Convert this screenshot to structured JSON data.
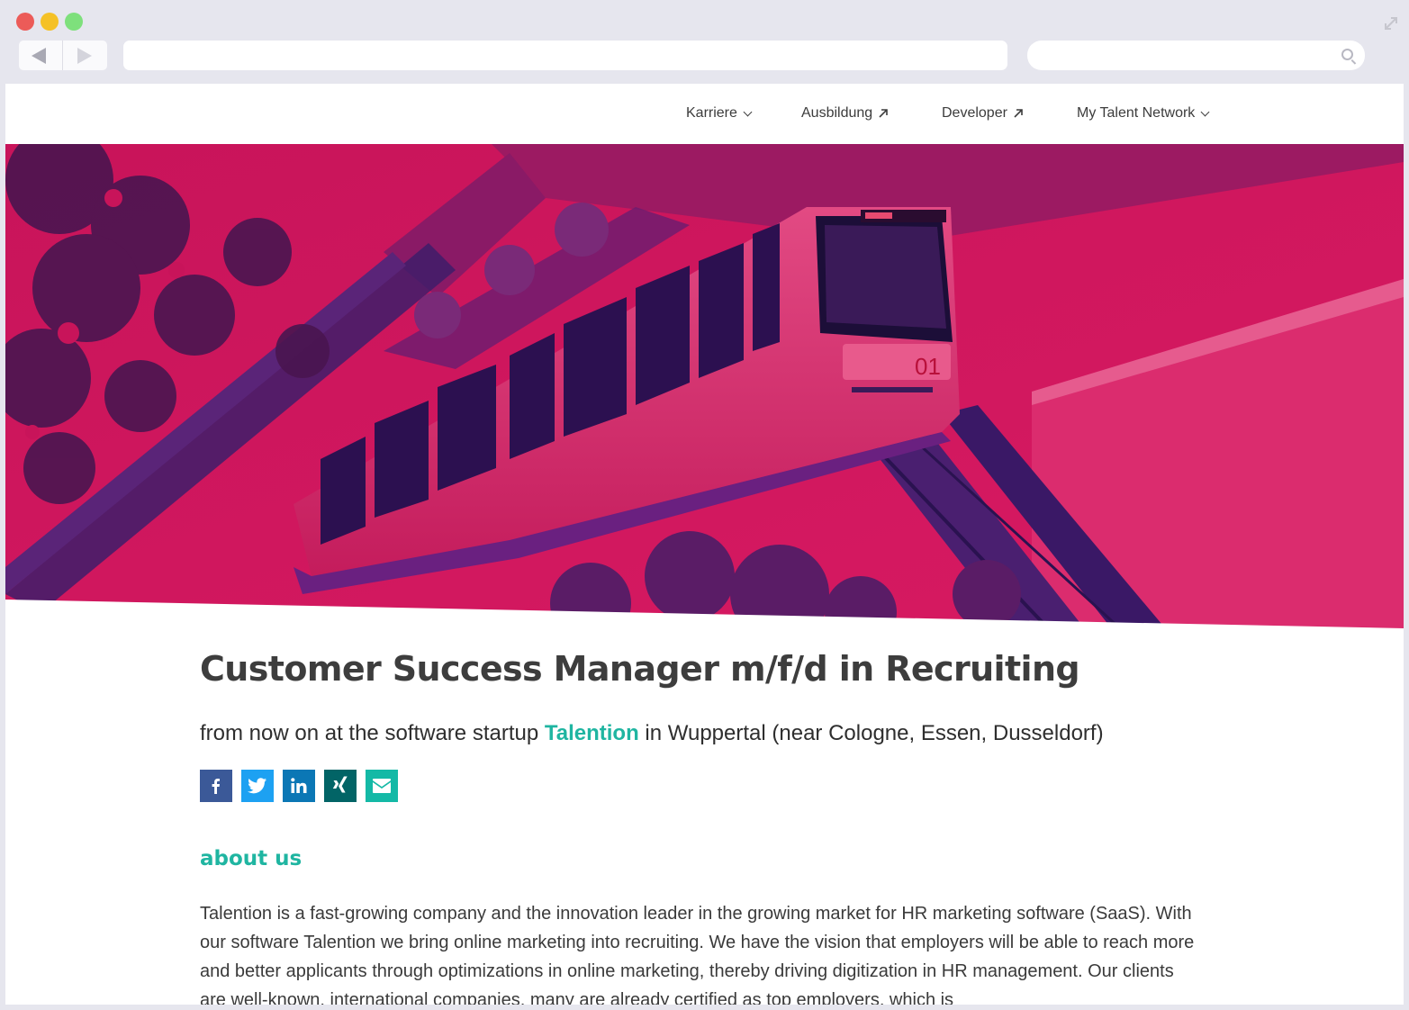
{
  "browser": {
    "url": "",
    "search_placeholder": ""
  },
  "nav": {
    "items": [
      {
        "label": "Karriere",
        "icon": "chevron-down-icon"
      },
      {
        "label": "Ausbildung",
        "icon": "external-arrow-icon"
      },
      {
        "label": "Developer",
        "icon": "external-arrow-icon"
      },
      {
        "label": "My Talent Network",
        "icon": "chevron-down-icon"
      }
    ]
  },
  "hero": {
    "tint_color": "#d4145a",
    "train_number": "01"
  },
  "job": {
    "title": "Customer Success Manager m/f/d in Recruiting",
    "sub_prefix": "from now on at the software startup",
    "company": "Talention",
    "sub_suffix": "in Wuppertal (near Cologne, Essen, Dusseldorf)"
  },
  "share": [
    {
      "name": "facebook-icon",
      "glyph": "f",
      "color": "#3b5998"
    },
    {
      "name": "twitter-icon",
      "glyph": "t",
      "color": "#1da1f2"
    },
    {
      "name": "linkedin-icon",
      "glyph": "in",
      "color": "#0b77b5"
    },
    {
      "name": "xing-icon",
      "glyph": "x",
      "color": "#026466"
    },
    {
      "name": "email-icon",
      "glyph": "mail",
      "color": "#14b9a6"
    }
  ],
  "about": {
    "heading": "about us",
    "text": "Talention is a fast-growing company and the innovation leader in the growing market for HR marketing software (SaaS). With our software Talention we bring online marketing into recruiting. We have the vision that employers will be able to reach more and better applicants through optimizations in online marketing, thereby driving digitization in HR management. Our clients are well-known, international companies, many are already certified as top employers, which is"
  },
  "colors": {
    "accent": "#1fb5a1",
    "hero_magenta": "#d4145a",
    "title": "#3d3d3d"
  }
}
